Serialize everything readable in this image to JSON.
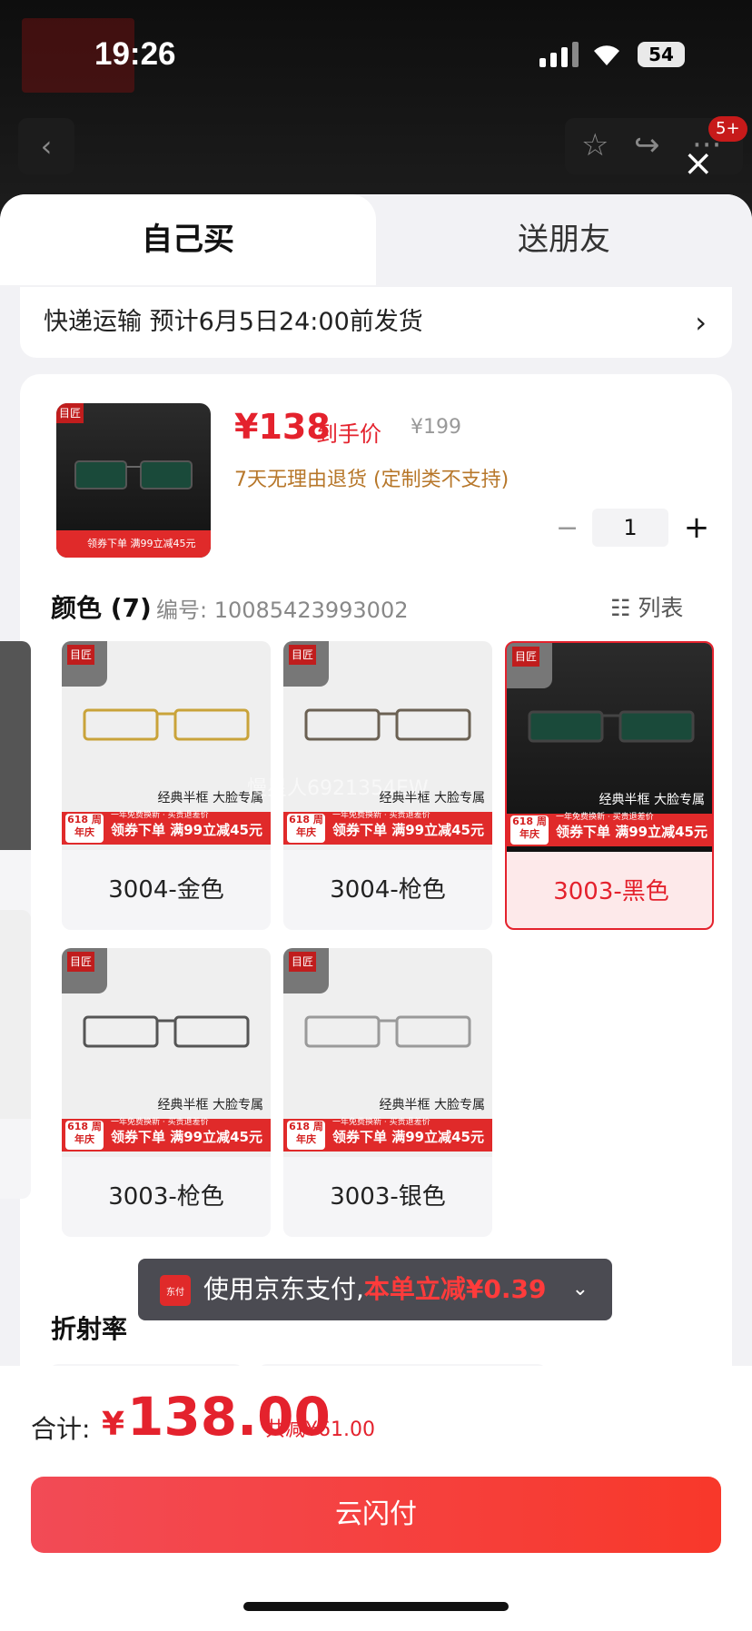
{
  "status": {
    "time": "19:26",
    "battery": "54"
  },
  "nav": {
    "badge": "5+"
  },
  "tabs": {
    "self": "自己买",
    "gift": "送朋友"
  },
  "shipping": {
    "text": "快递运输 预计6月5日24:00前发货"
  },
  "product": {
    "price": "¥138",
    "price_note": "到手价",
    "original_price": "¥199",
    "refund_policy": "7天无理由退货 (定制类不支持)",
    "quantity": "1",
    "thumb_promo": "领券下单 满99立减45元"
  },
  "colors": {
    "header": "颜色 (7)",
    "code": "编号: 10085423993002",
    "list_view": "列表",
    "caption": "经典半框 大脸专属",
    "promo": "领券下单 满99立减45元",
    "promo_small": "一年免费换新 · 买贵退差价",
    "tag618": "618 周年庆",
    "items": [
      {
        "label": "3004-金色",
        "selected": false
      },
      {
        "label": "3004-枪色",
        "selected": false
      },
      {
        "label": "3003-黑色",
        "selected": true
      },
      {
        "label": "3003-枪色",
        "selected": false
      },
      {
        "label": "3003-银色",
        "selected": false
      }
    ]
  },
  "refraction": {
    "label": "折射率"
  },
  "toast": {
    "icon_text": "东付",
    "text": "使用京东支付,",
    "highlight": "本单立减¥0.39"
  },
  "footer": {
    "total_label": "合计:",
    "currency": "¥",
    "total_amount": "138.00",
    "discount": "共减¥61.00",
    "pay_button": "云闪付"
  },
  "watermark": "慢星人6921354EW",
  "accent_color": "#e4222d"
}
